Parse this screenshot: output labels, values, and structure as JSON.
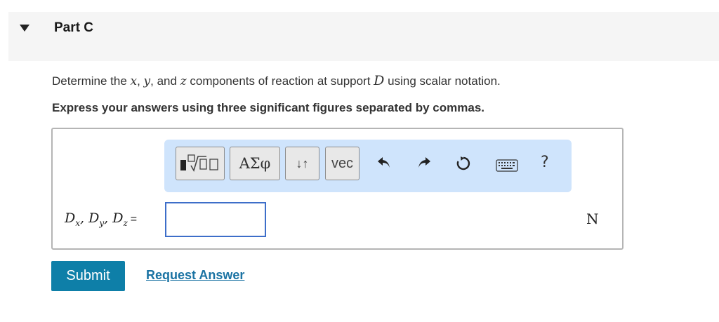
{
  "part": {
    "title": "Part C"
  },
  "instruction": {
    "prefix": "Determine the ",
    "var_x": "x",
    "sep1": ", ",
    "var_y": "y",
    "sep2": ", and ",
    "var_z": "z",
    "middle": " components of reaction at support ",
    "var_D": "D",
    "suffix": " using scalar notation."
  },
  "express": "Express your answers using three significant figures separated by commas.",
  "toolbar": {
    "greek_label": "ΑΣφ",
    "arrows_label": "↓↑",
    "vec_label": "vec",
    "help_label": "?"
  },
  "answer": {
    "label_D": "D",
    "sub_x": "x",
    "sub_y": "y",
    "sub_z": "z",
    "comma": ", ",
    "equals": "=",
    "value": "",
    "unit": "N"
  },
  "actions": {
    "submit_label": "Submit",
    "request_label": "Request Answer"
  },
  "colors": {
    "toolbar_bg": "#cfe4fc",
    "submit_bg": "#0e7fa8",
    "link": "#1b73a3",
    "input_border": "#3d6ec9"
  }
}
